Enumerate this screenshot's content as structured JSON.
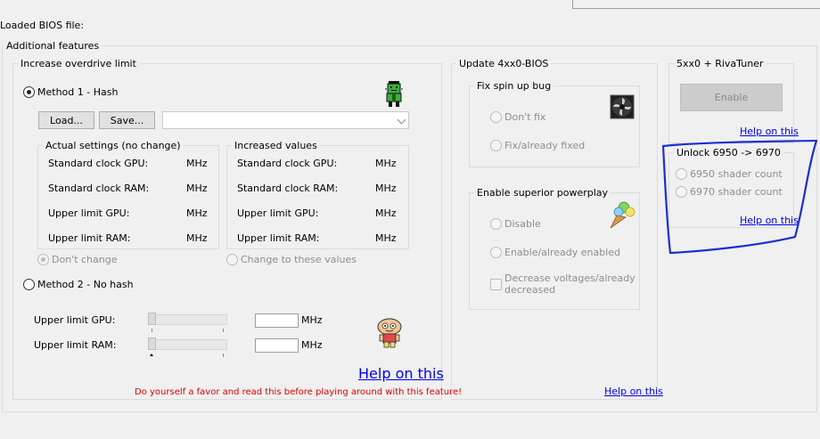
{
  "header": {
    "loaded_bios_label": "Loaded BIOS file:"
  },
  "additional_features": {
    "title": "Additional features"
  },
  "overdrive": {
    "title": "Increase overdrive limit",
    "method1_label": "Method 1 - Hash",
    "method2_label": "Method 2 - No hash",
    "load_label": "Load...",
    "save_label": "Save...",
    "file_value": "",
    "actual": {
      "title": "Actual settings (no change)",
      "rows": [
        {
          "label": "Standard clock GPU:",
          "unit": "MHz"
        },
        {
          "label": "Standard clock RAM:",
          "unit": "MHz"
        },
        {
          "label": "Upper limit GPU:",
          "unit": "MHz"
        },
        {
          "label": "Upper limit RAM:",
          "unit": "MHz"
        }
      ]
    },
    "increased": {
      "title": "Increased values",
      "rows": [
        {
          "label": "Standard clock GPU:",
          "unit": "MHz"
        },
        {
          "label": "Standard clock RAM:",
          "unit": "MHz"
        },
        {
          "label": "Upper limit GPU:",
          "unit": "MHz"
        },
        {
          "label": "Upper limit RAM:",
          "unit": "MHz"
        }
      ]
    },
    "dont_change_label": "Don't change",
    "change_values_label": "Change to these values",
    "method2_gpu_label": "Upper limit GPU:",
    "method2_ram_label": "Upper limit RAM:",
    "method2_gpu_value": "",
    "method2_ram_value": "",
    "method2_unit": "MHz",
    "help_label": "Help on this",
    "warning": "Do yourself a favor and read this before playing around with this feature!"
  },
  "update_4xx0": {
    "title": "Update 4xx0-BIOS",
    "fix_spin": {
      "title": "Fix spin up bug",
      "dont_fix_label": "Don't fix",
      "fix_label": "Fix/already fixed"
    },
    "powerplay": {
      "title": "Enable superior powerplay",
      "disable_label": "Disable",
      "enable_label": "Enable/already enabled",
      "decrease_line1": "Decrease voltages/already",
      "decrease_line2": "decreased"
    },
    "help_label": "Help on this"
  },
  "rivatuner": {
    "title": "5xx0 + RivaTuner",
    "enable_label": "Enable",
    "help_label": "Help on this"
  },
  "unlock": {
    "title": "Unlock 6950 -> 6970",
    "opt1_label": "6950 shader count",
    "opt2_label": "6970 shader count",
    "help_label": "Help on this"
  },
  "colors": {
    "warning_red": "#dd0000",
    "link_blue": "#0000ee",
    "annotation_blue": "#1a2fd0"
  }
}
